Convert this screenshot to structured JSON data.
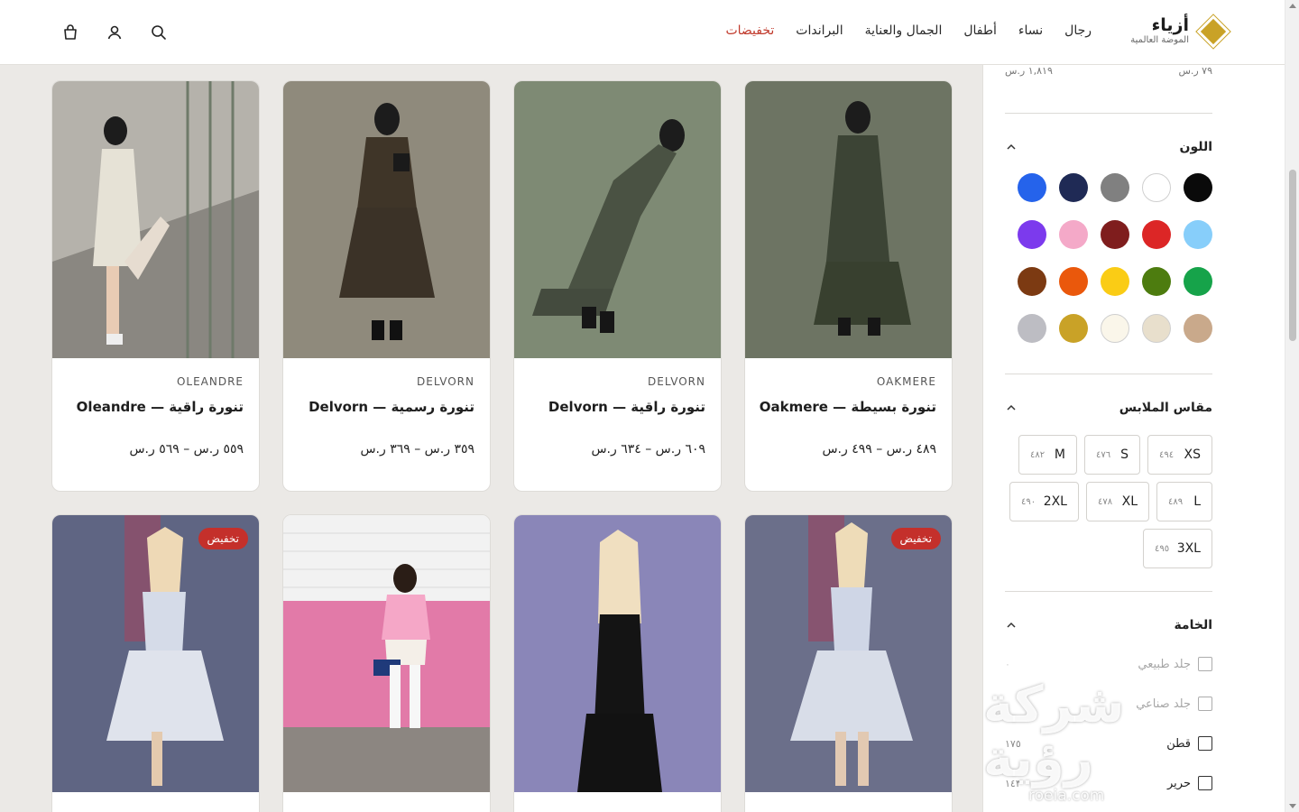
{
  "header": {
    "logo_title": "أزياء",
    "logo_subtitle": "الموضة العالمية",
    "nav": [
      "رجال",
      "نساء",
      "أطفال",
      "الجمال والعناية",
      "البراندات",
      "تخفيضات"
    ],
    "icons": [
      "search-icon",
      "user-icon",
      "shopping-bag-icon"
    ]
  },
  "sidebar": {
    "price_min": "٧٩ ر.س",
    "price_max": "١,٨١٩ ر.س",
    "color_title": "اللون",
    "colors": [
      "#0a0a0a",
      "#ffffff",
      "#808080",
      "#1f2a55",
      "#2563eb",
      "#87cefa",
      "#dc2626",
      "#7f1d1d",
      "#f4a9c8",
      "#7c3aed",
      "#16a34a",
      "#4d7c0f",
      "#facc15",
      "#ea580c",
      "#7c3a12",
      "#c9a98b",
      "#e8dfcc",
      "#faf6ea",
      "#c9a227",
      "#bdbdc3"
    ],
    "size_title": "مقاس الملابس",
    "sizes": [
      {
        "label": "XS",
        "count": "٤٩٤"
      },
      {
        "label": "S",
        "count": "٤٧٦"
      },
      {
        "label": "M",
        "count": "٤٨٢"
      },
      {
        "label": "L",
        "count": "٤٨٩"
      },
      {
        "label": "XL",
        "count": "٤٧٨"
      },
      {
        "label": "2XL",
        "count": "٤٩٠"
      },
      {
        "label": "3XL",
        "count": "٤٩٥"
      }
    ],
    "material_title": "الخامة",
    "materials": [
      {
        "label": "جلد طبيعي",
        "count": "٠"
      },
      {
        "label": "جلد صناعي",
        "count": ""
      },
      {
        "label": "قطن",
        "count": "١٧٥"
      },
      {
        "label": "حرير",
        "count": "١٤٣"
      }
    ]
  },
  "watermark": {
    "arabic": "شركة رؤية",
    "latin": "roeia.com"
  },
  "products": [
    {
      "brand": "OAKMERE",
      "name": "تنورة بسيطة — Oakmere",
      "price": "٤٨٩ ر.س – ٤٩٩ ر.س",
      "badge": ""
    },
    {
      "brand": "DELVORN",
      "name": "تنورة راقية — Delvorn",
      "price": "٦٠٩ ر.س – ٦٣٤ ر.س",
      "badge": ""
    },
    {
      "brand": "DELVORN",
      "name": "تنورة رسمية — Delvorn",
      "price": "٣٥٩ ر.س – ٣٦٩ ر.س",
      "badge": ""
    },
    {
      "brand": "OLEANDRE",
      "name": "تنورة راقية — Oleandre",
      "price": "٥٥٩ ر.س – ٥٦٩ ر.س",
      "badge": ""
    },
    {
      "brand": "",
      "name": "",
      "price": "",
      "badge": "تخفيض"
    },
    {
      "brand": "",
      "name": "",
      "price": "",
      "badge": ""
    },
    {
      "brand": "",
      "name": "",
      "price": "",
      "badge": ""
    },
    {
      "brand": "",
      "name": "",
      "price": "",
      "badge": "تخفيض"
    }
  ]
}
